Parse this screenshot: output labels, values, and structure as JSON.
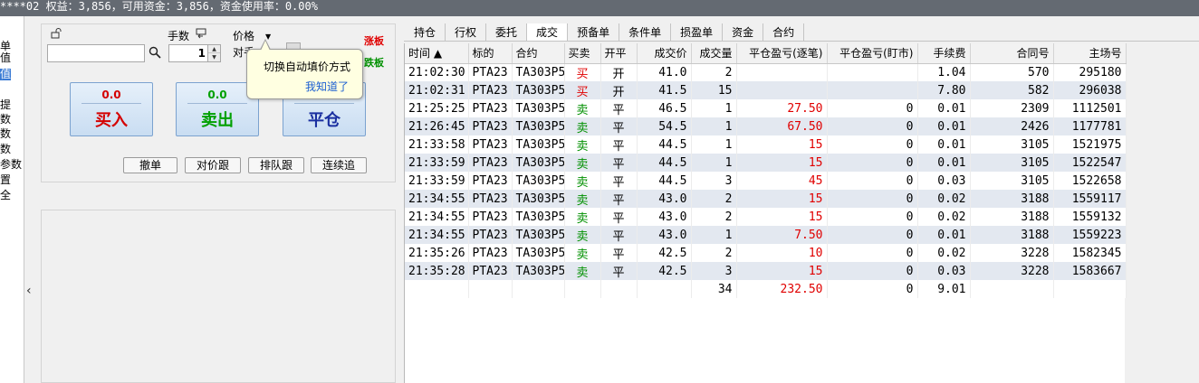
{
  "status": {
    "text": "****02 权益：3,856，可用资金：3,856，资金使用率：0.00%"
  },
  "left_strip": {
    "items": [
      "单",
      "值",
      "值",
      "",
      "提",
      "数",
      "数",
      "数",
      "参数",
      "置",
      "全"
    ]
  },
  "order": {
    "lock_icon": "unlock-icon",
    "code_value": "",
    "qty_label": "手数",
    "qty_value": "1",
    "price_label": "价格",
    "price_mode": "对手",
    "limit_up": "涨板",
    "limit_down": "跌板",
    "buy": {
      "price": "0.0",
      "label": "买入"
    },
    "sell": {
      "price": "0.0",
      "label": "卖出"
    },
    "close": {
      "price": "",
      "label": "平仓"
    },
    "buttons": [
      "撤单",
      "对价跟",
      "排队跟",
      "连续追"
    ],
    "tooltip": {
      "message": "切换自动填价方式",
      "ok": "我知道了"
    }
  },
  "tabs": [
    "持仓",
    "行权",
    "委托",
    "成交",
    "预备单",
    "条件单",
    "损盈单",
    "资金",
    "合约"
  ],
  "active_tab": "成交",
  "table": {
    "columns": [
      "时间 ▲",
      "标的",
      "合约",
      "买卖",
      "开平",
      "成交价",
      "成交量",
      "平仓盈亏(逐笔)",
      "平仓盈亏(盯市)",
      "手续费",
      "合同号",
      "主场号"
    ],
    "rows": [
      [
        "21:02:30",
        "PTA23",
        "TA303P5",
        "买",
        "开",
        "41.0",
        "2",
        "",
        "",
        "1.04",
        "570",
        "295180"
      ],
      [
        "21:02:31",
        "PTA23",
        "TA303P5",
        "买",
        "开",
        "41.5",
        "15",
        "",
        "",
        "7.80",
        "582",
        "296038"
      ],
      [
        "21:25:25",
        "PTA23",
        "TA303P5",
        "卖",
        "平",
        "46.5",
        "1",
        "27.50",
        "0",
        "0.01",
        "2309",
        "1112501"
      ],
      [
        "21:26:45",
        "PTA23",
        "TA303P5",
        "卖",
        "平",
        "54.5",
        "1",
        "67.50",
        "0",
        "0.01",
        "2426",
        "1177781"
      ],
      [
        "21:33:58",
        "PTA23",
        "TA303P5",
        "卖",
        "平",
        "44.5",
        "1",
        "15",
        "0",
        "0.01",
        "3105",
        "1521975"
      ],
      [
        "21:33:59",
        "PTA23",
        "TA303P5",
        "卖",
        "平",
        "44.5",
        "1",
        "15",
        "0",
        "0.01",
        "3105",
        "1522547"
      ],
      [
        "21:33:59",
        "PTA23",
        "TA303P5",
        "卖",
        "平",
        "44.5",
        "3",
        "45",
        "0",
        "0.03",
        "3105",
        "1522658"
      ],
      [
        "21:34:55",
        "PTA23",
        "TA303P5",
        "卖",
        "平",
        "43.0",
        "2",
        "15",
        "0",
        "0.02",
        "3188",
        "1559117"
      ],
      [
        "21:34:55",
        "PTA23",
        "TA303P5",
        "卖",
        "平",
        "43.0",
        "2",
        "15",
        "0",
        "0.02",
        "3188",
        "1559132"
      ],
      [
        "21:34:55",
        "PTA23",
        "TA303P5",
        "卖",
        "平",
        "43.0",
        "1",
        "7.50",
        "0",
        "0.01",
        "3188",
        "1559223"
      ],
      [
        "21:35:26",
        "PTA23",
        "TA303P5",
        "卖",
        "平",
        "42.5",
        "2",
        "10",
        "0",
        "0.02",
        "3228",
        "1582345"
      ],
      [
        "21:35:28",
        "PTA23",
        "TA303P5",
        "卖",
        "平",
        "42.5",
        "3",
        "15",
        "0",
        "0.03",
        "3228",
        "1583667"
      ]
    ],
    "totals": {
      "volume": "34",
      "pnl_trade": "232.50",
      "pnl_mtm": "0",
      "fee": "9.01"
    }
  },
  "colors": {
    "buy": "#d40000",
    "sell": "#009000",
    "profit": "#e00000",
    "row_alt": "#e3e8f0"
  }
}
